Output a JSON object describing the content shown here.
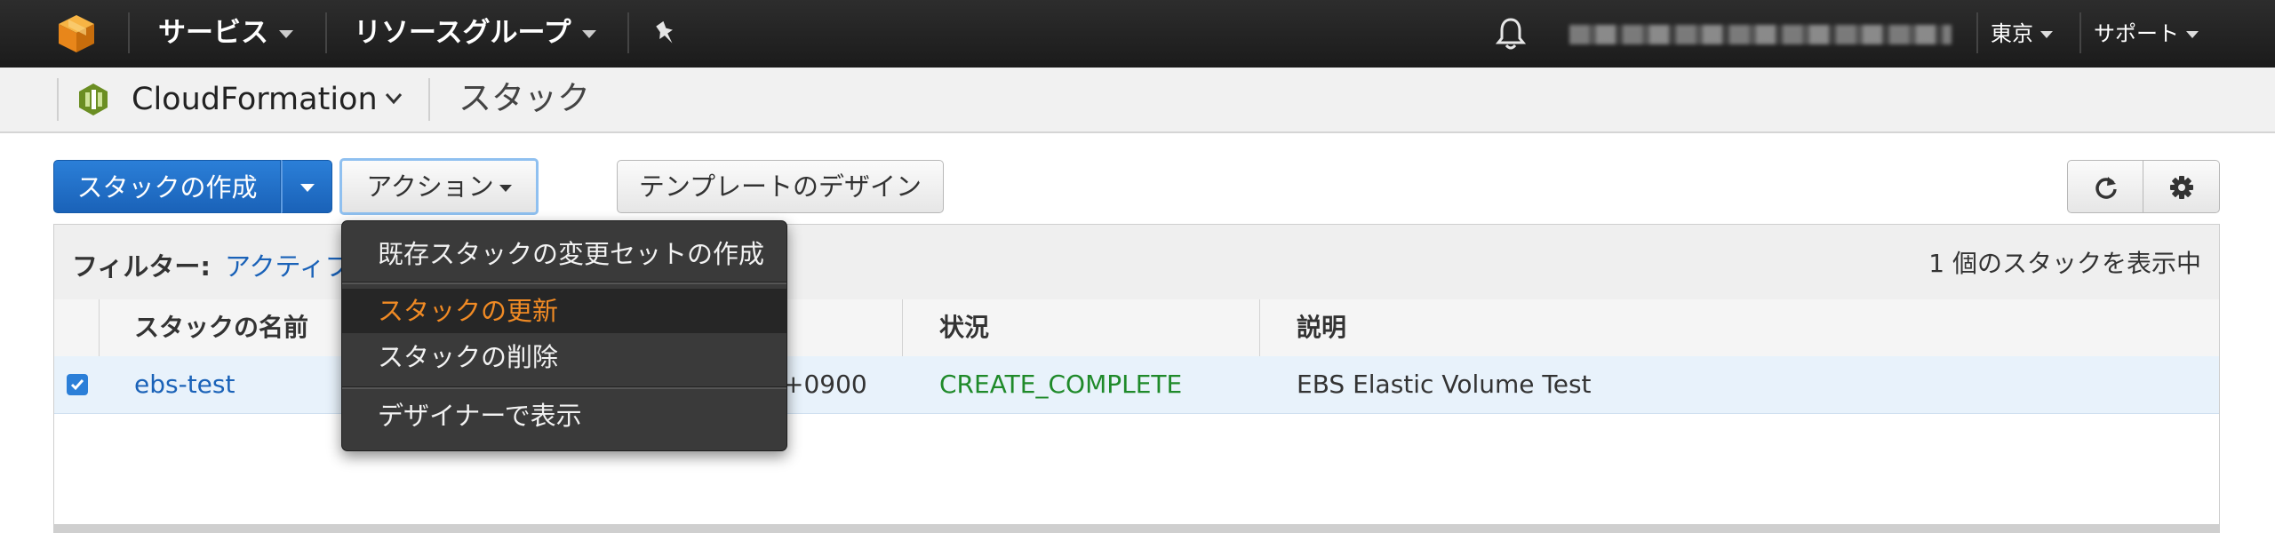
{
  "topbar": {
    "services": "サービス",
    "resource_groups": "リソースグループ",
    "region": "東京",
    "support": "サポート"
  },
  "servicebar": {
    "service_name": "CloudFormation",
    "page_title": "スタック"
  },
  "toolbar": {
    "create_stack": "スタックの作成",
    "actions": "アクション",
    "template_design": "テンプレートのデザイン"
  },
  "filter": {
    "label": "フィルター:",
    "value": "アクティブ",
    "count_text": "1 個のスタックを表示中"
  },
  "table": {
    "headers": [
      "スタックの名前",
      "状況",
      "説明"
    ],
    "rows": [
      {
        "selected": true,
        "name": "ebs-test",
        "created_time_visible": "+0900",
        "status": "CREATE_COMPLETE",
        "description": "EBS Elastic Volume Test"
      }
    ]
  },
  "menu": {
    "items": [
      {
        "label": "既存スタックの変更セットの作成"
      },
      {
        "label": "スタックの更新",
        "highlighted": true
      },
      {
        "label": "スタックの削除"
      },
      {
        "label": "デザイナーで表示"
      }
    ]
  },
  "colors": {
    "primary_blue": "#1e6fc8",
    "status_complete": "#1f8a2a",
    "menu_highlight": "#f08a24",
    "topbar_bg": "#232323"
  },
  "icons": [
    "aws-cube-icon",
    "pin-icon",
    "bell-icon",
    "cloudformation-icon",
    "refresh-icon",
    "gear-icon",
    "checkbox-icon"
  ]
}
